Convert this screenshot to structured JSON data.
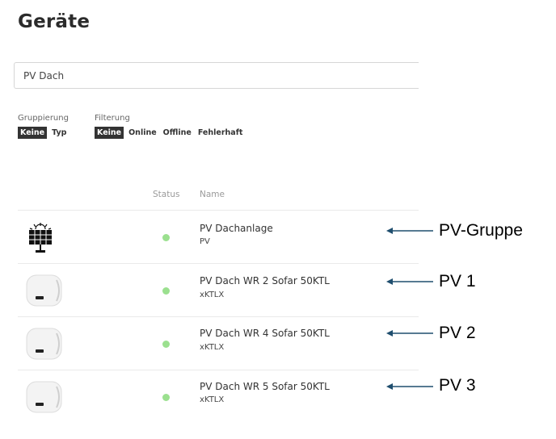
{
  "header": {
    "title": "Geräte"
  },
  "search": {
    "value": "PV Dach"
  },
  "grouping": {
    "label": "Gruppierung",
    "options": [
      "Keine",
      "Typ"
    ],
    "active": "Keine"
  },
  "filtering": {
    "label": "Filterung",
    "options": [
      "Keine",
      "Online",
      "Offline",
      "Fehlerhaft"
    ],
    "active": "Keine"
  },
  "table": {
    "headers": {
      "status": "Status",
      "name": "Name"
    },
    "rows": [
      {
        "icon": "solar-panel-icon",
        "status": "online",
        "name": "PV Dachanlage",
        "type": "PV"
      },
      {
        "icon": "inverter-icon",
        "status": "online",
        "name": "PV Dach WR 2 Sofar 50KTL",
        "type": "xKTLX"
      },
      {
        "icon": "inverter-icon",
        "status": "online",
        "name": "PV Dach WR 4 Sofar 50KTL",
        "type": "xKTLX"
      },
      {
        "icon": "inverter-icon",
        "status": "online",
        "name": "PV Dach WR 5 Sofar 50KTL",
        "type": "xKTLX"
      }
    ]
  },
  "annotations": [
    "PV-Gruppe",
    "PV 1",
    "PV 2",
    "PV 3"
  ],
  "colors": {
    "status_online": "#9be08f",
    "arrow": "#1f4e6e",
    "active_chip": "#333333"
  }
}
